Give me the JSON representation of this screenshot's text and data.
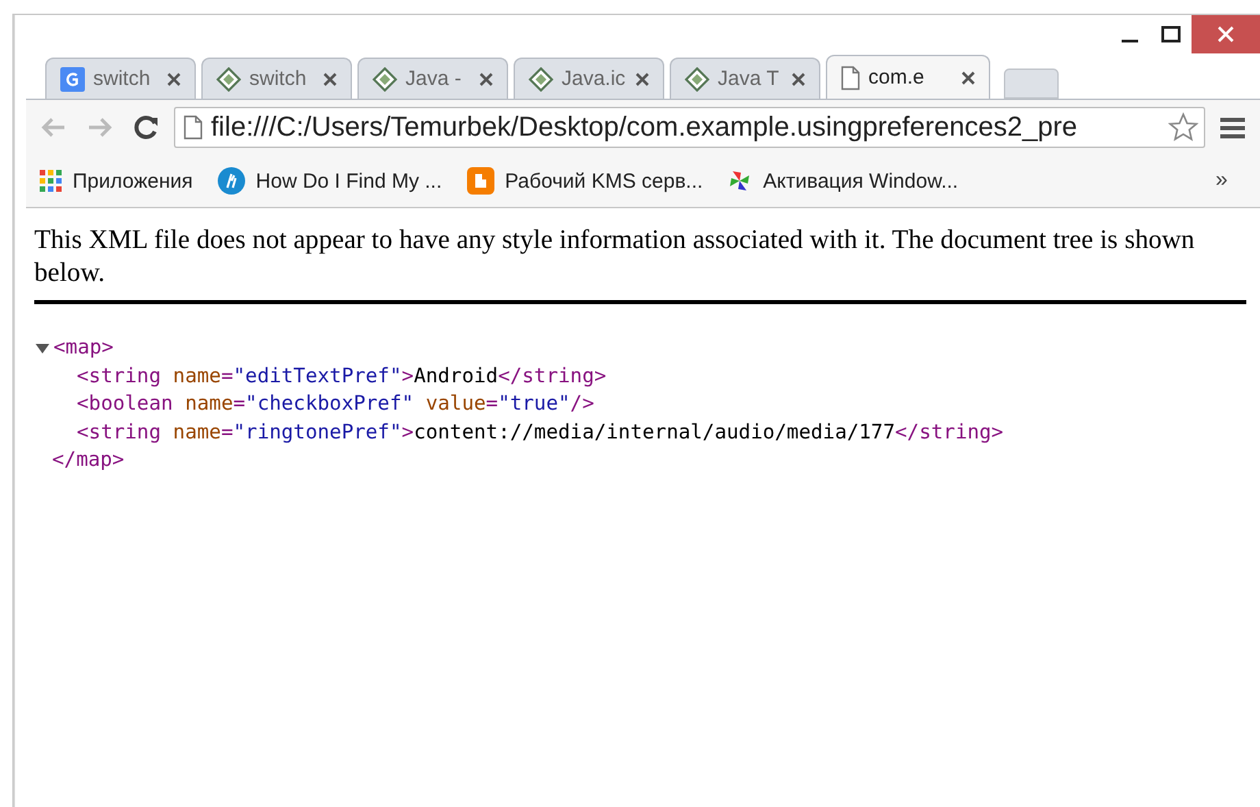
{
  "tabs": [
    {
      "title": "switch",
      "kind": "google",
      "selected": false
    },
    {
      "title": "switch",
      "kind": "site",
      "selected": false
    },
    {
      "title": "Java -",
      "kind": "site",
      "selected": false
    },
    {
      "title": "Java.ic",
      "kind": "site",
      "selected": false
    },
    {
      "title": "Java T",
      "kind": "site",
      "selected": false
    },
    {
      "title": "com.e",
      "kind": "file",
      "selected": true
    }
  ],
  "address_bar": {
    "value": "file:///C:/Users/Temurbek/Desktop/com.example.usingpreferences2_pre"
  },
  "bookmarks": [
    {
      "label": "Приложения",
      "kind": "apps"
    },
    {
      "label": "How Do I Find My ...",
      "kind": "hp"
    },
    {
      "label": "Рабочий KMS серв...",
      "kind": "blogger"
    },
    {
      "label": "Активация Window...",
      "kind": "pinwheel"
    }
  ],
  "bookmarks_overflow": "»",
  "notice": "This XML file does not appear to have any style information associated with it. The document tree is shown below.",
  "xml": {
    "expanded": true,
    "open_tag": "<map>",
    "close_tag": "</map>",
    "children": [
      {
        "tokens": [
          {
            "kind": "tag",
            "text": "<string"
          },
          {
            "kind": "attr",
            "text": " name"
          },
          {
            "kind": "tag",
            "text": "="
          },
          {
            "kind": "value",
            "text": "\"editTextPref\""
          },
          {
            "kind": "tag",
            "text": ">"
          },
          {
            "kind": "text",
            "text": "Android"
          },
          {
            "kind": "tag",
            "text": "</string>"
          }
        ]
      },
      {
        "tokens": [
          {
            "kind": "tag",
            "text": "<boolean"
          },
          {
            "kind": "attr",
            "text": " name"
          },
          {
            "kind": "tag",
            "text": "="
          },
          {
            "kind": "value",
            "text": "\"checkboxPref\""
          },
          {
            "kind": "attr",
            "text": " value"
          },
          {
            "kind": "tag",
            "text": "="
          },
          {
            "kind": "value",
            "text": "\"true\""
          },
          {
            "kind": "tag",
            "text": "/>"
          }
        ]
      },
      {
        "tokens": [
          {
            "kind": "tag",
            "text": "<string"
          },
          {
            "kind": "attr",
            "text": " name"
          },
          {
            "kind": "tag",
            "text": "="
          },
          {
            "kind": "value",
            "text": "\"ringtonePref\""
          },
          {
            "kind": "tag",
            "text": ">"
          },
          {
            "kind": "text",
            "text": "content://media/internal/audio/media/177"
          },
          {
            "kind": "tag",
            "text": "</string>"
          }
        ]
      }
    ]
  }
}
